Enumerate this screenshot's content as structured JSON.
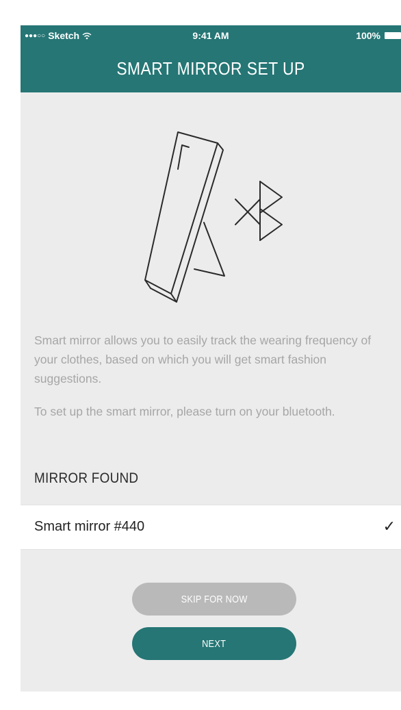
{
  "status_bar": {
    "carrier": "Sketch",
    "time": "9:41 AM",
    "battery": "100%"
  },
  "header": {
    "title": "SMART MIRROR SET UP"
  },
  "description": {
    "paragraph1": "Smart mirror allows you to easily track the wearing frequency of your clothes, based on which you will get smart fashion suggestions.",
    "paragraph2": "To set up the smart mirror, please turn on your bluetooth."
  },
  "mirror_section": {
    "label": "MIRROR FOUND",
    "devices": [
      {
        "name": "Smart mirror #440",
        "selected": true
      }
    ]
  },
  "buttons": {
    "skip_label": "SKIP FOR NOW",
    "next_label": "NEXT"
  },
  "icons": {
    "illustration": "mirror-stand-illustration",
    "bluetooth": "bluetooth-icon",
    "check": "checkmark-icon"
  },
  "colors": {
    "accent": "#257675",
    "background": "#ececec",
    "skip_button": "#b9b9b9",
    "description_text": "#a6a6a6"
  }
}
